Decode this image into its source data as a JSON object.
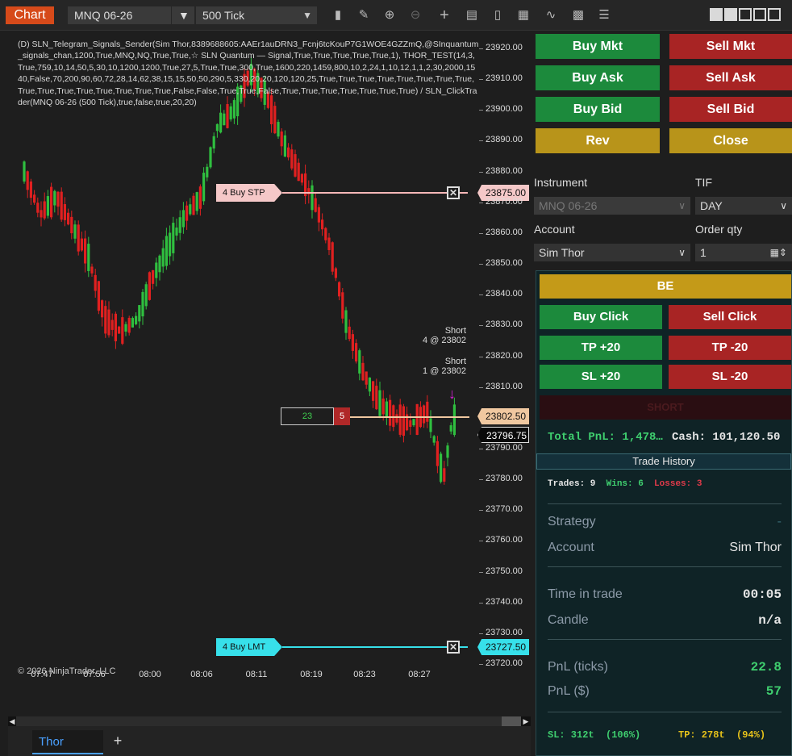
{
  "toolbar": {
    "chart_tab": "Chart",
    "instrument": "MNQ 06-26",
    "interval": "500 Tick",
    "dropdown_glyph": "▼"
  },
  "chart": {
    "indicator_text": "(D) SLN_Telegram_Signals_Sender(Sim Thor,8389688605:AAEr1auDRN3_Fcnj6tcKouP7G1WOE4GZZmQ,@SInquantum_signals_chan,1200,True,MNQ,NQ,True,True,☆ SLN Quantum — Signal,True,True,True,True,True,1), THOR_TEST(14,3,True,759,10,14,50,5,30,10,1200,1200,True,27,5,True,True,300,True,1600,220,1459,800,10,2,24,1,10,12,1,1,2,30,2000,1540,False,70,200,90,60,72,28,14,62,38,15,15,50,50,290,5,330,20,20,120,120,25,True,True,True,True,True,True,True,True,True,True,True,True,True,True,True,True,False,False,True,True,False,True,True,True,True,True,True,True) / SLN_ClickTrader(MNQ 06-26 (500 Tick),true,false,true,20,20)",
    "price_labels": [
      "23920.00",
      "23910.00",
      "23900.00",
      "23890.00",
      "23880.00",
      "23870.00",
      "23860.00",
      "23850.00",
      "23840.00",
      "23830.00",
      "23820.00",
      "23810.00",
      "23790.00",
      "23780.00",
      "23770.00",
      "23760.00",
      "23750.00",
      "23740.00",
      "23730.00",
      "23720.00"
    ],
    "time_labels": [
      "07:47",
      "07:56",
      "08:00",
      "08:06",
      "08:11",
      "08:19",
      "08:23",
      "08:27"
    ],
    "orders": {
      "buy_stp": {
        "label": "4  Buy STP",
        "price": "23875.00"
      },
      "buy_lmt": {
        "label": "4  Buy LMT",
        "price": "23727.50"
      },
      "position": {
        "qty_long": "23",
        "qty_short": "5",
        "price": "23802.50"
      },
      "last_price": "23796.75"
    },
    "executions": [
      {
        "line1": "Short",
        "line2": "4 @ 23802"
      },
      {
        "line1": "Short",
        "line2": "1 @ 23802"
      }
    ],
    "copyright": "© 2026 NinjaTrader, LLC"
  },
  "tabs": {
    "active": "Thor",
    "add": "+"
  },
  "order_entry": {
    "buy_mkt": "Buy Mkt",
    "sell_mkt": "Sell Mkt",
    "buy_ask": "Buy Ask",
    "sell_ask": "Sell Ask",
    "buy_bid": "Buy Bid",
    "sell_bid": "Sell Bid",
    "rev": "Rev",
    "close": "Close",
    "instrument_label": "Instrument",
    "instrument_value": "MNQ 06-26",
    "tif_label": "TIF",
    "tif_value": "DAY",
    "account_label": "Account",
    "account_value": "Sim Thor",
    "qty_label": "Order qty",
    "qty_value": "1"
  },
  "click_trader": {
    "be": "BE",
    "buy_click": "Buy Click",
    "sell_click": "Sell Click",
    "tp_plus": "TP +20",
    "tp_minus": "TP -20",
    "sl_plus": "SL +20",
    "sl_minus": "SL -20",
    "position_state": "SHORT",
    "total_pnl": "Total PnL: 1,478…",
    "cash": "Cash: 101,120.50",
    "trade_history": "Trade History",
    "trades": "Trades: 9",
    "wins": "Wins: 6",
    "losses": "Losses: 3",
    "strategy_label": "Strategy",
    "strategy_value": "-",
    "account_label": "Account",
    "account_value": "Sim Thor",
    "time_label": "Time in trade",
    "time_value": "00:05",
    "candle_label": "Candle",
    "candle_value": "n/a",
    "pnl_ticks_label": "PnL (ticks)",
    "pnl_ticks_value": "22.8",
    "pnl_usd_label": "PnL ($)",
    "pnl_usd_value": "57",
    "sl_info": "SL: 312t  (106%)",
    "tp_info": "TP: 278t  (94%)"
  },
  "colors": {
    "up": "#2fbf3f",
    "down": "#e02020",
    "buy_stp": "#f5b8b8",
    "buy_lmt": "#37e0ea",
    "position_line": "#f0c8a0"
  }
}
